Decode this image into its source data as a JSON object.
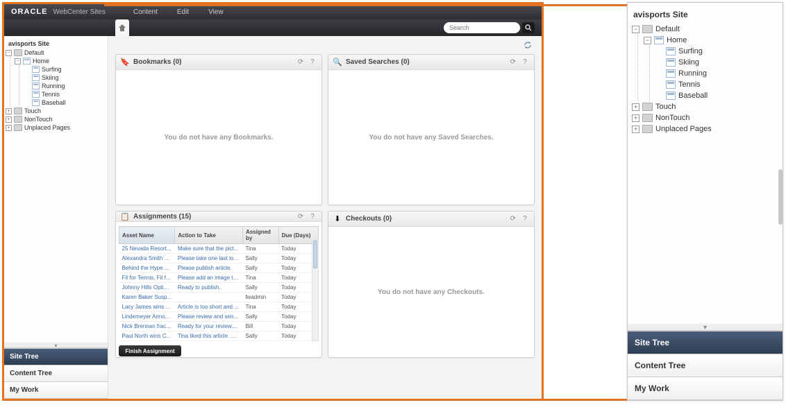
{
  "brand": {
    "vendor": "ORACLE",
    "product": "WebCenter Sites"
  },
  "menus": {
    "content": "Content",
    "edit": "Edit",
    "view": "View"
  },
  "search": {
    "placeholder": "Search"
  },
  "site_title": "avisports Site",
  "tree": {
    "root": "Default",
    "home": "Home",
    "pages": [
      "Surfing",
      "Skiing",
      "Running",
      "Tennis",
      "Baseball"
    ],
    "folders": [
      "Touch",
      "NonTouch",
      "Unplaced Pages"
    ]
  },
  "sidebar_tabs": {
    "site": "Site Tree",
    "content_tree": "Content Tree",
    "mywork": "My Work"
  },
  "panels": {
    "bookmarks": {
      "title": "Bookmarks (0)",
      "empty": "You do not have any Bookmarks."
    },
    "saved": {
      "title": "Saved Searches (0)",
      "empty": "You do not have any Saved Searches."
    },
    "assignments": {
      "title": "Assignments (15)",
      "cols": {
        "name": "Asset Name",
        "action": "Action to Take",
        "by": "Assigned by",
        "due": "Due (Days)"
      },
      "rows": [
        {
          "name": "25 Nevada Resort...",
          "action": "Make sure that the pict...",
          "by": "Tina",
          "due": "Today"
        },
        {
          "name": "Alexandra Smith E...",
          "action": "Please take one last loo...",
          "by": "Sally",
          "due": "Today"
        },
        {
          "name": "Behind the Hype o...",
          "action": "Please publish article.",
          "by": "Sally",
          "due": "Today"
        },
        {
          "name": "Fit for Tennis, Fit f...",
          "action": "Please add an image to...",
          "by": "Tina",
          "due": "Today"
        },
        {
          "name": "Johnny Hills Optimi...",
          "action": "Ready to publish.",
          "by": "Sally",
          "due": "Today"
        },
        {
          "name": "Karen Baker Susp...",
          "action": "",
          "by": "fwadmin",
          "due": "Today"
        },
        {
          "name": "Lacy James wins ...",
          "action": "Article is too short and ...",
          "by": "Tina",
          "due": "Today"
        },
        {
          "name": "Lindemeyer Anno...",
          "action": "Please review and sen...",
          "by": "Sally",
          "due": "Today"
        },
        {
          "name": "Nick Brennan frac...",
          "action": "Ready for your review....",
          "by": "Bill",
          "due": "Today"
        },
        {
          "name": "Paul North wins C...",
          "action": "Tina liked this article. Pl...",
          "by": "Sally",
          "due": "Today"
        }
      ],
      "finish": "Finish Assignment"
    },
    "checkouts": {
      "title": "Checkouts (0)",
      "empty": "You do not have any Checkouts."
    }
  }
}
